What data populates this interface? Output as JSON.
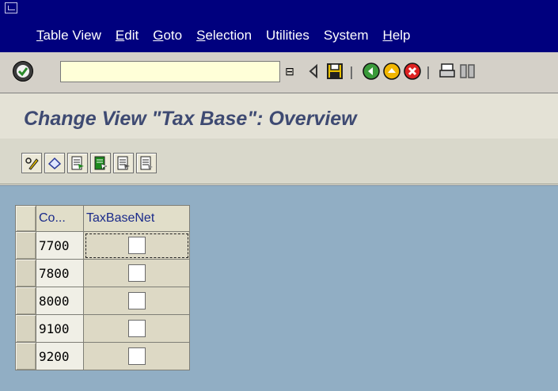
{
  "menu": {
    "items": [
      {
        "u": "T",
        "rest": "able View"
      },
      {
        "u": "E",
        "rest": "dit"
      },
      {
        "u": "G",
        "rest": "oto"
      },
      {
        "u": "S",
        "rest": "election"
      },
      {
        "u": "",
        "rest": "Utilities"
      },
      {
        "u": "",
        "rest": "System"
      },
      {
        "u": "H",
        "rest": "elp"
      }
    ]
  },
  "toolbar": {
    "command_value": "",
    "dropdown_glyph": "⊟"
  },
  "title": "Change View \"Tax Base\": Overview",
  "table": {
    "headers": [
      "Co...",
      "TaxBaseNet"
    ],
    "rows": [
      "7700",
      "7800",
      "8000",
      "9100",
      "9200"
    ],
    "checked": [
      false,
      false,
      false,
      false,
      false
    ]
  },
  "colors": {
    "menubar": "#00007e",
    "workarea": "#91aec4",
    "title": "#3e4a72"
  }
}
